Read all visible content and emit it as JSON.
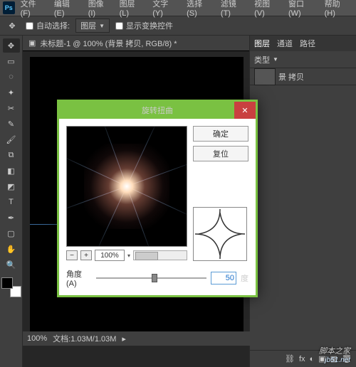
{
  "app": {
    "logo": "Ps"
  },
  "menu": [
    "文件(F)",
    "编辑(E)",
    "图像(I)",
    "图层(L)",
    "文字(Y)",
    "选择(S)",
    "滤镜(T)",
    "视图(V)",
    "窗口(W)",
    "帮助(H)"
  ],
  "options": {
    "auto_select": "自动选择:",
    "dropdown": "图层",
    "show_transform": "显示变换控件"
  },
  "doc": {
    "tab": "未标题-1 @ 100% (背景 拷贝, RGB/8) *"
  },
  "status": {
    "zoom": "100%",
    "info": "文档:1.03M/1.03M"
  },
  "panels": {
    "tabs": [
      "图层",
      "通道",
      "路径"
    ],
    "kind": "类型",
    "layer_name": "景 拷贝"
  },
  "dialog": {
    "title": "旋转扭曲",
    "ok": "确定",
    "reset": "复位",
    "zoom": "100%",
    "angle_label": "角度(A)",
    "angle_value": "50",
    "angle_unit": "度"
  },
  "watermark": {
    "main": "脚本之家",
    "sub": "jb51.net"
  },
  "colors": {
    "accent": "#7ac142",
    "danger": "#c94040"
  }
}
